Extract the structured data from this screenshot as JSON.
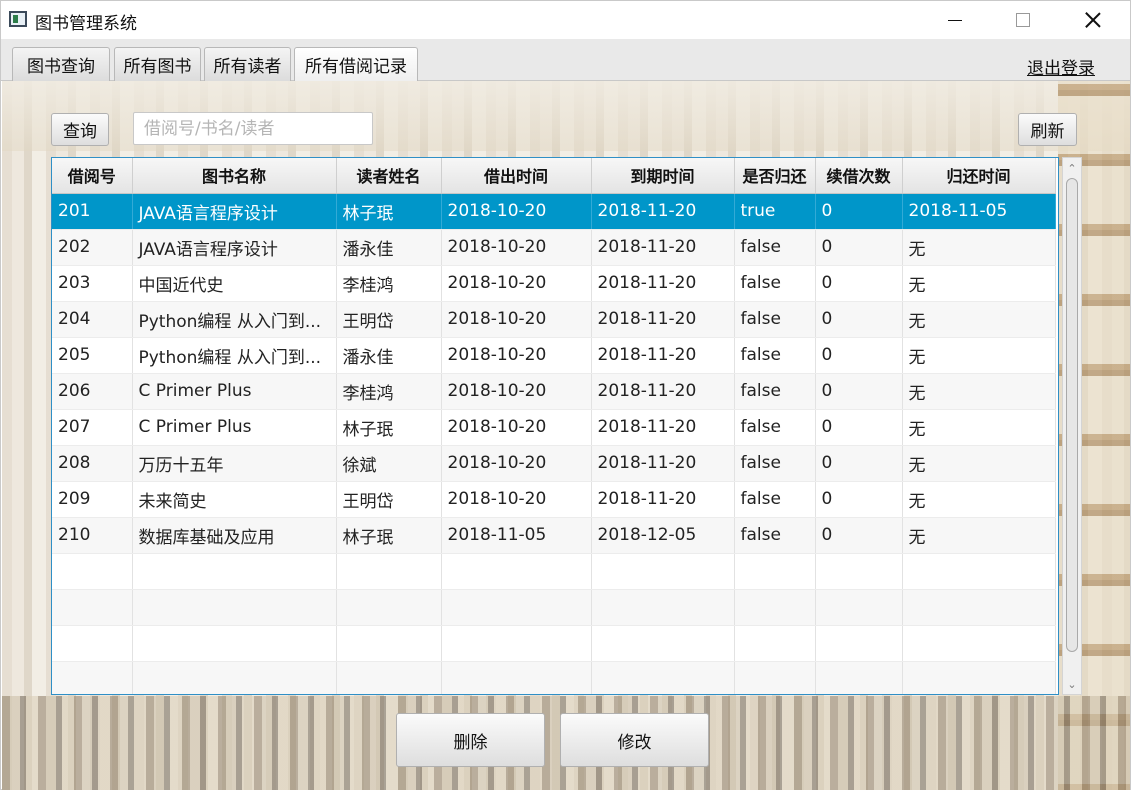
{
  "window": {
    "title": "图书管理系统",
    "minimize_symbol": "",
    "maximize_symbol": "",
    "close_symbol": ""
  },
  "tabs": [
    {
      "label": "图书查询",
      "selected": false
    },
    {
      "label": "所有图书",
      "selected": false
    },
    {
      "label": "所有读者",
      "selected": false
    },
    {
      "label": "所有借阅记录",
      "selected": true
    }
  ],
  "logout_label": "退出登录",
  "toolbar": {
    "query_label": "查询",
    "search_placeholder": "借阅号/书名/读者",
    "search_value": "",
    "refresh_label": "刷新"
  },
  "table": {
    "columns": [
      "借阅号",
      "图书名称",
      "读者姓名",
      "借出时间",
      "到期时间",
      "是否归还",
      "续借次数",
      "归还时间"
    ],
    "rows": [
      [
        "201",
        "JAVA语言程序设计",
        "林子珉",
        "2018-10-20",
        "2018-11-20",
        "true",
        "0",
        "2018-11-05"
      ],
      [
        "202",
        "JAVA语言程序设计",
        "潘永佳",
        "2018-10-20",
        "2018-11-20",
        "false",
        "0",
        "无"
      ],
      [
        "203",
        "中国近代史",
        "李桂鸿",
        "2018-10-20",
        "2018-11-20",
        "false",
        "0",
        "无"
      ],
      [
        "204",
        "Python编程 从入门到...",
        "王明岱",
        "2018-10-20",
        "2018-11-20",
        "false",
        "0",
        "无"
      ],
      [
        "205",
        "Python编程 从入门到...",
        "潘永佳",
        "2018-10-20",
        "2018-11-20",
        "false",
        "0",
        "无"
      ],
      [
        "206",
        "C Primer Plus",
        "李桂鸿",
        "2018-10-20",
        "2018-11-20",
        "false",
        "0",
        "无"
      ],
      [
        "207",
        "C Primer Plus",
        "林子珉",
        "2018-10-20",
        "2018-11-20",
        "false",
        "0",
        "无"
      ],
      [
        "208",
        "万历十五年",
        "徐斌",
        "2018-10-20",
        "2018-11-20",
        "false",
        "0",
        "无"
      ],
      [
        "209",
        "未来简史",
        "王明岱",
        "2018-10-20",
        "2018-11-20",
        "false",
        "0",
        "无"
      ],
      [
        "210",
        "数据库基础及应用",
        "林子珉",
        "2018-11-05",
        "2018-12-05",
        "false",
        "0",
        "无"
      ]
    ],
    "selected_row": 0
  },
  "actions": {
    "delete_label": "删除",
    "edit_label": "修改"
  },
  "colors": {
    "selection": "#0096c9",
    "table_border": "#2f8fc6"
  }
}
